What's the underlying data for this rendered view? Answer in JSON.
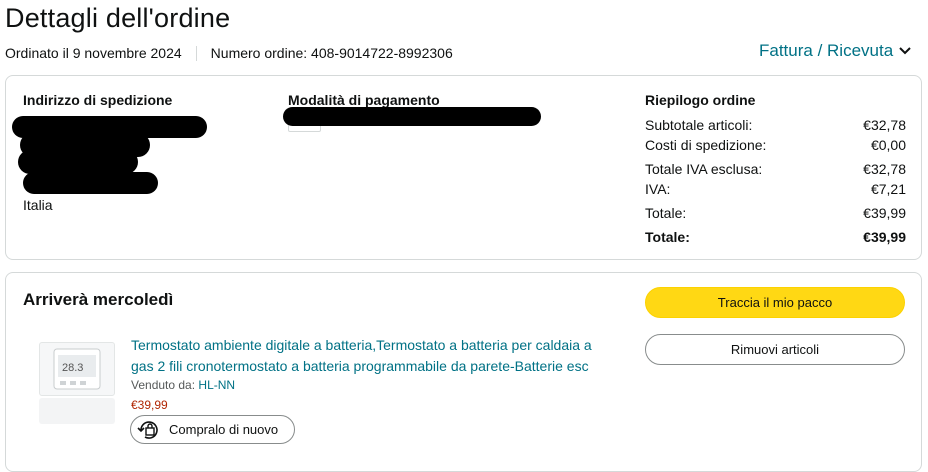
{
  "page": {
    "title": "Dettagli dell'ordine",
    "order_date": "Ordinato il 9 novembre 2024",
    "order_number": "Numero ordine: 408-9014722-8992306",
    "invoice_link": "Fattura / Ricevuta"
  },
  "shipping": {
    "heading": "Indirizzo di spedizione",
    "country": "Italia"
  },
  "payment": {
    "heading": "Modalità di pagamento"
  },
  "summary": {
    "heading": "Riepilogo ordine",
    "rows": [
      {
        "label": "Subtotale articoli:",
        "value": "€32,78"
      },
      {
        "label": "Costi di spedizione:",
        "value": "€0,00"
      },
      {
        "label": "Totale IVA esclusa:",
        "value": "€32,78"
      },
      {
        "label": "IVA:",
        "value": "€7,21"
      },
      {
        "label": "Totale:",
        "value": "€39,99"
      },
      {
        "label": "Totale:",
        "value": "€39,99"
      }
    ]
  },
  "delivery": {
    "heading": "Arriverà mercoledì",
    "track_button": "Traccia il mio pacco",
    "remove_button": "Rimuovi articoli"
  },
  "product": {
    "title": "Termostato ambiente digitale a batteria,Termostato a batteria per caldaia a gas 2 fili cronotermostato a batteria programmabile da parete-Batterie esc",
    "sold_by_label": "Venduto da:",
    "seller": "HL-NN",
    "price": "€39,99",
    "buy_again": "Compralo di nuovo"
  }
}
